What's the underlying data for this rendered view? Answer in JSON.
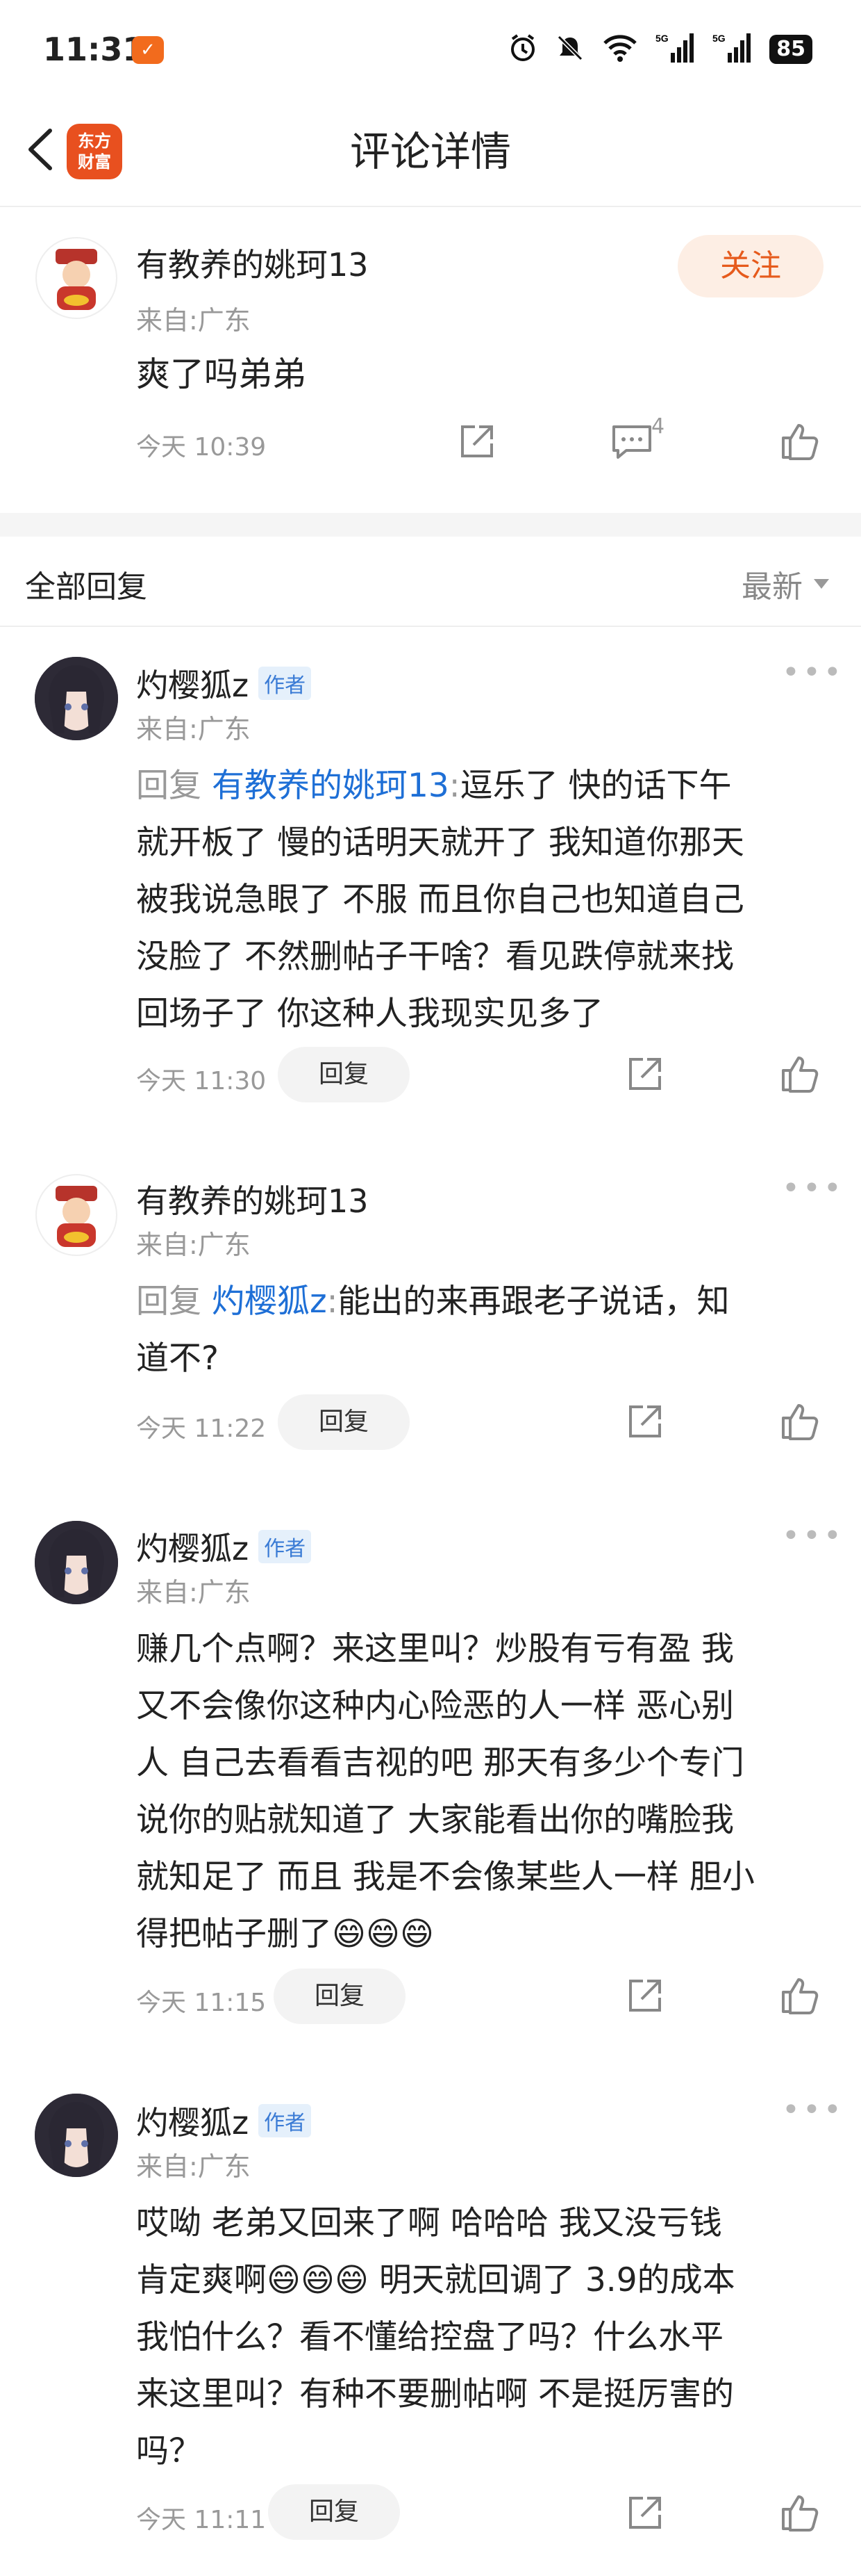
{
  "status": {
    "time": "11:31",
    "app_badge": "✓",
    "battery": "85"
  },
  "nav": {
    "title": "评论详情",
    "logo_line1": "东方",
    "logo_line2": "财富"
  },
  "post": {
    "name": "有教养的姚珂13",
    "source": "来自:广东",
    "text": "爽了吗弟弟",
    "time": "今天 10:39",
    "follow": "关注",
    "reply_count": "4"
  },
  "replies_header": {
    "label": "全部回复",
    "sort": "最新"
  },
  "replies": [
    {
      "name": "灼樱狐z",
      "tag": "作者",
      "source": "来自:广东",
      "prefix": "回复 ",
      "mention": "有教养的姚珂13",
      "sep": ":",
      "line1": "逗乐了 快的话下午",
      "lines": [
        "就开板了 慢的话明天就开了 我知道你那天",
        "被我说急眼了 不服 而且你自己也知道自己",
        "没脸了 不然删帖子干啥？看见跌停就来找",
        "回场子了 你这种人我现实见多了"
      ],
      "time": "今天 11:30",
      "reply": "回复"
    },
    {
      "name": "有教养的姚珂13",
      "source": "来自:广东",
      "prefix": "回复 ",
      "mention": "灼樱狐z",
      "sep": ":",
      "line1": "能出的来再跟老子说话，知",
      "lines": [
        "道不?"
      ],
      "time": "今天 11:22",
      "reply": "回复"
    },
    {
      "name": "灼樱狐z",
      "tag": "作者",
      "source": "来自:广东",
      "lines": [
        "赚几个点啊？来这里叫？炒股有亏有盈 我",
        "又不会像你这种内心险恶的人一样 恶心别",
        "人 自己去看看吉视的吧 那天有多少个专门",
        "说你的贴就知道了 大家能看出你的嘴脸我",
        "就知足了 而且 我是不会像某些人一样 胆小",
        "得把帖子删了😄😄😄"
      ],
      "time": "今天 11:15",
      "reply": "回复"
    },
    {
      "name": "灼樱狐z",
      "tag": "作者",
      "source": "来自:广东",
      "lines": [
        "哎呦 老弟又回来了啊 哈哈哈 我又没亏钱",
        "肯定爽啊😄😄😄 明天就回调了 3.9的成本",
        "我怕什么？看不懂给控盘了吗？什么水平",
        "来这里叫？有种不要删帖啊 不是挺厉害的",
        "吗？"
      ],
      "time": "今天 11:11",
      "reply": "回复"
    }
  ],
  "colors": {
    "accent": "#e65a1c",
    "mention": "#1e6fd6",
    "author_tag": "#3a7bd5"
  },
  "icons": [
    "back-arrow-icon",
    "share-icon",
    "comment-icon",
    "like-icon",
    "more-icon",
    "sort-arrow-icon"
  ]
}
